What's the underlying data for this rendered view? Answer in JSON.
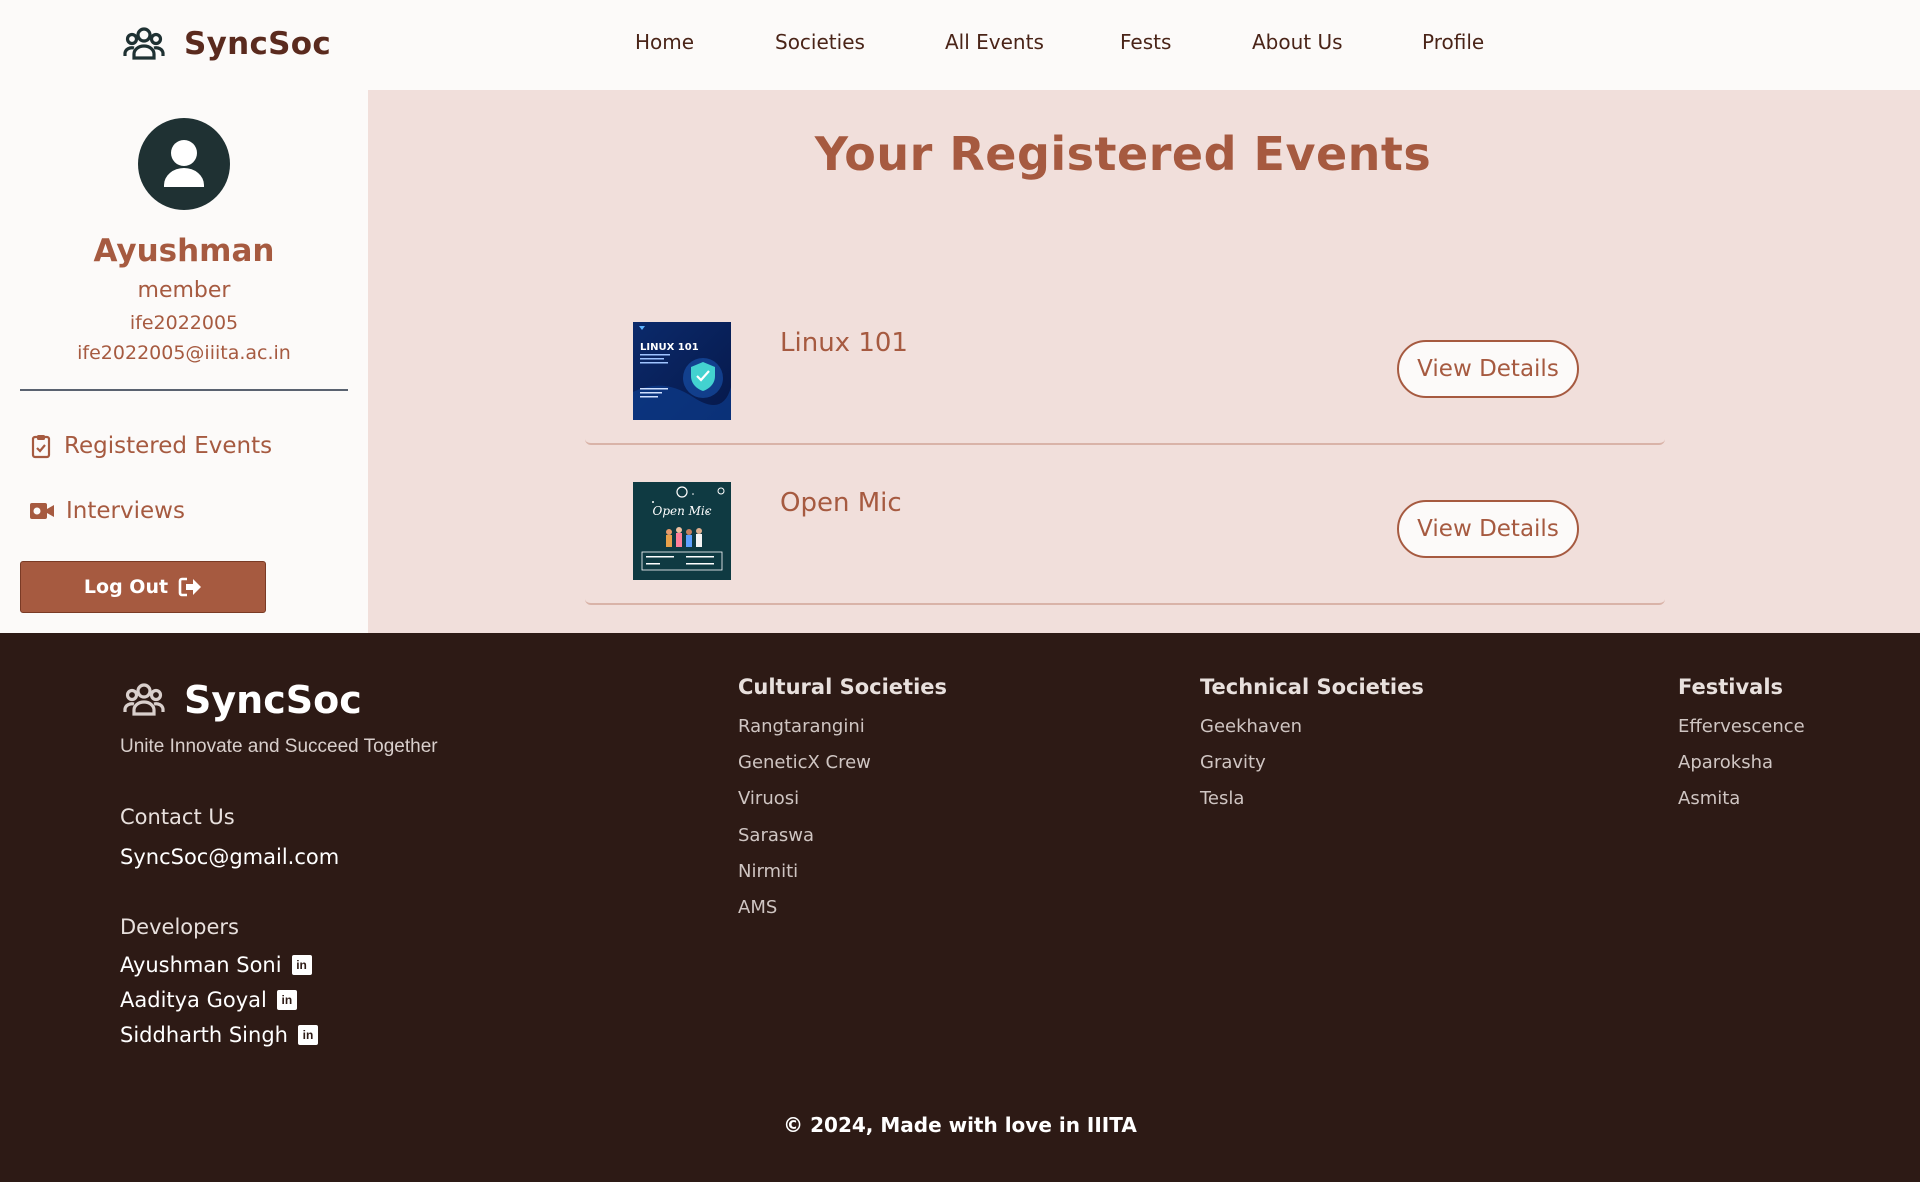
{
  "brand": {
    "name": "SyncSoc",
    "icon": "users-group-icon"
  },
  "nav": [
    "Home",
    "Societies",
    "All Events",
    "Fests",
    "About Us",
    "Profile"
  ],
  "profile": {
    "name": "Ayushman",
    "role": "member",
    "id": "ife2022005",
    "email": "ife2022005@iiita.ac.in"
  },
  "sidebar": {
    "items": [
      {
        "label": "Registered Events",
        "icon": "clipboard-check-icon"
      },
      {
        "label": "Interviews",
        "icon": "video-camera-icon"
      }
    ],
    "logout_label": "Log Out"
  },
  "main": {
    "title": "Your Registered Events",
    "events": [
      {
        "name": "Linux 101",
        "button": "View Details",
        "poster_text": "LINUX 101"
      },
      {
        "name": "Open Mic",
        "button": "View Details",
        "poster_text": "Open Mic"
      }
    ]
  },
  "footer": {
    "brand": "SyncSoc",
    "tagline": "Unite Innovate and Succeed Together",
    "contact_heading": "Contact Us",
    "contact_email": "SyncSoc@gmail.com",
    "developers_heading": "Developers",
    "developers": [
      "Ayushman Soni",
      "Aaditya Goyal",
      "Siddharth Singh"
    ],
    "cultural_heading": "Cultural Societies",
    "cultural": [
      "Rangtarangini",
      "GeneticX Crew",
      "Viruosi",
      "Saraswa",
      "Nirmiti",
      "AMS"
    ],
    "technical_heading": "Technical Societies",
    "technical": [
      "Geekhaven",
      "Gravity",
      "Tesla"
    ],
    "festivals_heading": "Festivals",
    "festivals": [
      "Effervescence",
      "Aparoksha",
      "Asmita"
    ],
    "copyright": "© 2024, Made with love in IIITA"
  },
  "colors": {
    "accent": "#a65a40",
    "dark": "#2d1a15",
    "main_bg": "#f1dfdb",
    "header_bg": "#fcfaf9"
  }
}
